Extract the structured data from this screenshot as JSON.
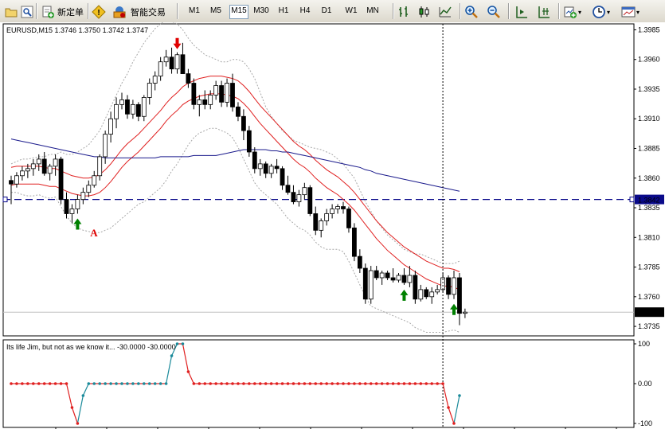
{
  "toolbar": {
    "new_order": "新定单",
    "auto_trading": "智能交易",
    "timeframes": [
      "M1",
      "M5",
      "M15",
      "M30",
      "H1",
      "H4",
      "D1",
      "W1",
      "MN"
    ],
    "active_timeframe": "M15",
    "icons": [
      "open-folder-icon",
      "zoom-fit-icon",
      "new-order-icon",
      "alert-icon",
      "auto-trading-icon",
      "bar-chart-icon",
      "candlestick-icon",
      "line-chart-icon",
      "zoom-in-icon",
      "zoom-out-icon",
      "chart-shift-icon",
      "autoscroll-icon",
      "add-indicator-icon",
      "period-clock-icon",
      "template-icon"
    ]
  },
  "chart_data": [
    {
      "type": "candlestick",
      "title": "EURUSD,M15  1.3746 1.3750 1.3742 1.3747",
      "ylim": [
        1.3727,
        1.399
      ],
      "yticks": [
        "1.3985",
        "1.3960",
        "1.3935",
        "1.3910",
        "1.3885",
        "1.3860",
        "1.3835",
        "1.3810",
        "1.3785",
        "1.3760",
        "1.3735"
      ],
      "current_price": "1.3747",
      "hline_price": "1.3842",
      "candles": [
        [
          1.3858,
          1.3862,
          1.3838,
          1.3855
        ],
        [
          1.3855,
          1.3865,
          1.3852,
          1.3862
        ],
        [
          1.3862,
          1.387,
          1.3858,
          1.3866
        ],
        [
          1.3866,
          1.3872,
          1.386,
          1.3868
        ],
        [
          1.3868,
          1.3876,
          1.3862,
          1.3872
        ],
        [
          1.3872,
          1.388,
          1.3866,
          1.3876
        ],
        [
          1.3876,
          1.3882,
          1.3862,
          1.3864
        ],
        [
          1.3864,
          1.3872,
          1.3858,
          1.387
        ],
        [
          1.387,
          1.388,
          1.3862,
          1.3876
        ],
        [
          1.3876,
          1.3878,
          1.3838,
          1.3842
        ],
        [
          1.3842,
          1.3848,
          1.3826,
          1.383
        ],
        [
          1.383,
          1.3838,
          1.3822,
          1.3834
        ],
        [
          1.3834,
          1.3846,
          1.383,
          1.3842
        ],
        [
          1.3842,
          1.3852,
          1.3838,
          1.3848
        ],
        [
          1.3848,
          1.3858,
          1.3844,
          1.3854
        ],
        [
          1.3854,
          1.3866,
          1.3852,
          1.3862
        ],
        [
          1.3862,
          1.388,
          1.3858,
          1.3878
        ],
        [
          1.3878,
          1.39,
          1.3872,
          1.3897
        ],
        [
          1.3897,
          1.3916,
          1.389,
          1.391
        ],
        [
          1.391,
          1.3928,
          1.3902,
          1.3922
        ],
        [
          1.3922,
          1.3932,
          1.3918,
          1.3926
        ],
        [
          1.3926,
          1.393,
          1.391,
          1.3914
        ],
        [
          1.3914,
          1.3926,
          1.391,
          1.3922
        ],
        [
          1.3922,
          1.3924,
          1.3908,
          1.3912
        ],
        [
          1.3912,
          1.393,
          1.3908,
          1.3928
        ],
        [
          1.3928,
          1.3944,
          1.3922,
          1.394
        ],
        [
          1.394,
          1.395,
          1.3934,
          1.3946
        ],
        [
          1.3946,
          1.3962,
          1.3942,
          1.3958
        ],
        [
          1.3958,
          1.3968,
          1.3954,
          1.3962
        ],
        [
          1.3962,
          1.397,
          1.3948,
          1.3952
        ],
        [
          1.3952,
          1.3966,
          1.3948,
          1.3964
        ],
        [
          1.3964,
          1.3974,
          1.3958,
          1.3948
        ],
        [
          1.3948,
          1.3952,
          1.3936,
          1.394
        ],
        [
          1.394,
          1.3944,
          1.3918,
          1.3922
        ],
        [
          1.3922,
          1.393,
          1.3912,
          1.3926
        ],
        [
          1.3926,
          1.3934,
          1.3918,
          1.3922
        ],
        [
          1.3922,
          1.3934,
          1.3918,
          1.393
        ],
        [
          1.393,
          1.3942,
          1.3926,
          1.3938
        ],
        [
          1.3938,
          1.3942,
          1.392,
          1.3924
        ],
        [
          1.3924,
          1.3944,
          1.392,
          1.394
        ],
        [
          1.394,
          1.3948,
          1.3916,
          1.392
        ],
        [
          1.392,
          1.3924,
          1.3908,
          1.3912
        ],
        [
          1.3912,
          1.3918,
          1.3892,
          1.39
        ],
        [
          1.39,
          1.3904,
          1.3878,
          1.3882
        ],
        [
          1.3882,
          1.3886,
          1.3864,
          1.3868
        ],
        [
          1.3868,
          1.3876,
          1.3862,
          1.3872
        ],
        [
          1.3872,
          1.3874,
          1.386,
          1.3864
        ],
        [
          1.3864,
          1.3872,
          1.386,
          1.387
        ],
        [
          1.387,
          1.3876,
          1.3864,
          1.3868
        ],
        [
          1.3868,
          1.387,
          1.385,
          1.3854
        ],
        [
          1.3854,
          1.3862,
          1.3846,
          1.3848
        ],
        [
          1.3848,
          1.3854,
          1.3838,
          1.384
        ],
        [
          1.384,
          1.385,
          1.3836,
          1.3846
        ],
        [
          1.3846,
          1.3856,
          1.3842,
          1.3852
        ],
        [
          1.3852,
          1.3854,
          1.3828,
          1.383
        ],
        [
          1.383,
          1.3836,
          1.3812,
          1.3816
        ],
        [
          1.3816,
          1.3826,
          1.381,
          1.3824
        ],
        [
          1.3824,
          1.3834,
          1.382,
          1.383
        ],
        [
          1.383,
          1.3838,
          1.3826,
          1.3834
        ],
        [
          1.3834,
          1.3838,
          1.383,
          1.3836
        ],
        [
          1.3836,
          1.384,
          1.383,
          1.3834
        ],
        [
          1.3834,
          1.3836,
          1.3814,
          1.3818
        ],
        [
          1.3818,
          1.3822,
          1.379,
          1.3794
        ],
        [
          1.3794,
          1.38,
          1.378,
          1.3784
        ],
        [
          1.3784,
          1.3788,
          1.3754,
          1.3758
        ],
        [
          1.3758,
          1.3786,
          1.3754,
          1.3782
        ],
        [
          1.3782,
          1.3786,
          1.3774,
          1.3776
        ],
        [
          1.3776,
          1.3782,
          1.377,
          1.378
        ],
        [
          1.378,
          1.3782,
          1.3774,
          1.3776
        ],
        [
          1.3776,
          1.3784,
          1.3772,
          1.3774
        ],
        [
          1.3774,
          1.378,
          1.3772,
          1.3778
        ],
        [
          1.3778,
          1.3784,
          1.377,
          1.3772
        ],
        [
          1.3772,
          1.3786,
          1.3768,
          1.3778
        ],
        [
          1.3778,
          1.3782,
          1.3754,
          1.3758
        ],
        [
          1.3758,
          1.377,
          1.3756,
          1.3766
        ],
        [
          1.3766,
          1.3768,
          1.3758,
          1.376
        ],
        [
          1.376,
          1.3768,
          1.3754,
          1.3764
        ],
        [
          1.3764,
          1.377,
          1.3762,
          1.3766
        ],
        [
          1.3766,
          1.378,
          1.3764,
          1.3776
        ],
        [
          1.3776,
          1.3778,
          1.3758,
          1.3762
        ],
        [
          1.3762,
          1.3782,
          1.3758,
          1.3776
        ],
        [
          1.3776,
          1.378,
          1.3736,
          1.3746
        ],
        [
          1.3746,
          1.375,
          1.3742,
          1.3747
        ]
      ],
      "overlays": [
        {
          "name": "bb-upper",
          "color": "#a8a8a8",
          "style": "dotted",
          "values": [
            1.3872,
            1.3874,
            1.3876,
            1.3876,
            1.3877,
            1.3878,
            1.3878,
            1.388,
            1.388,
            1.3882,
            1.388,
            1.388,
            1.3882,
            1.3885,
            1.3888,
            1.3894,
            1.39,
            1.391,
            1.392,
            1.393,
            1.394,
            1.3948,
            1.3958,
            1.3966,
            1.3974,
            1.398,
            1.3986,
            1.399,
            1.3994,
            1.3992,
            1.399,
            1.3985,
            1.3978,
            1.3972,
            1.3968,
            1.3964,
            1.3962,
            1.396,
            1.3958,
            1.3958,
            1.396,
            1.396,
            1.3958,
            1.3952,
            1.3944,
            1.3932,
            1.392,
            1.3912,
            1.3906,
            1.39,
            1.3896,
            1.3892,
            1.389,
            1.3888,
            1.3886,
            1.3885,
            1.3884,
            1.3882,
            1.388,
            1.3876,
            1.3872,
            1.3866,
            1.386,
            1.385,
            1.384,
            1.3832,
            1.3824,
            1.3818,
            1.3812,
            1.3808,
            1.3804,
            1.38,
            1.3798,
            1.3796,
            1.3796,
            1.3794,
            1.3792,
            1.379,
            1.3788,
            1.3788,
            1.3788,
            1.379
          ]
        },
        {
          "name": "bb-lower",
          "color": "#a8a8a8",
          "style": "dotted",
          "values": [
            1.3848,
            1.3848,
            1.3846,
            1.3845,
            1.3845,
            1.3846,
            1.3844,
            1.3843,
            1.3844,
            1.3836,
            1.3828,
            1.3822,
            1.3818,
            1.3816,
            1.3815,
            1.3814,
            1.3814,
            1.3816,
            1.3818,
            1.3822,
            1.3826,
            1.383,
            1.3834,
            1.3838,
            1.384,
            1.3844,
            1.3848,
            1.3852,
            1.3858,
            1.3866,
            1.3872,
            1.388,
            1.3888,
            1.3894,
            1.3898,
            1.39,
            1.3902,
            1.3902,
            1.39,
            1.3898,
            1.3894,
            1.3886,
            1.3876,
            1.3866,
            1.3856,
            1.385,
            1.3846,
            1.3842,
            1.3838,
            1.3832,
            1.3826,
            1.3822,
            1.3818,
            1.3816,
            1.3812,
            1.3806,
            1.3802,
            1.38,
            1.38,
            1.38,
            1.3798,
            1.379,
            1.378,
            1.377,
            1.376,
            1.3752,
            1.375,
            1.3748,
            1.3746,
            1.3744,
            1.3742,
            1.374,
            1.3738,
            1.3734,
            1.3732,
            1.373,
            1.373,
            1.373,
            1.373,
            1.3731,
            1.3732,
            1.373
          ]
        },
        {
          "name": "env-upper",
          "color": "#e02020",
          "style": "solid",
          "values": [
            1.3869,
            1.387,
            1.387,
            1.387,
            1.387,
            1.387,
            1.3869,
            1.3868,
            1.3868,
            1.3866,
            1.3864,
            1.3862,
            1.3861,
            1.386,
            1.386,
            1.3861,
            1.3863,
            1.3867,
            1.3872,
            1.3878,
            1.3884,
            1.3889,
            1.3893,
            1.3897,
            1.3902,
            1.3907,
            1.3912,
            1.3917,
            1.3923,
            1.3928,
            1.3932,
            1.3937,
            1.394,
            1.3942,
            1.3944,
            1.3945,
            1.3946,
            1.3946,
            1.3946,
            1.3945,
            1.3944,
            1.3942,
            1.3938,
            1.3933,
            1.3927,
            1.3921,
            1.3916,
            1.3911,
            1.3906,
            1.3901,
            1.3896,
            1.3891,
            1.3887,
            1.3884,
            1.388,
            1.3875,
            1.3871,
            1.3867,
            1.3864,
            1.3861,
            1.3857,
            1.3853,
            1.3848,
            1.3842,
            1.3836,
            1.383,
            1.3824,
            1.3819,
            1.3814,
            1.381,
            1.3806,
            1.3802,
            1.3799,
            1.3796,
            1.3793,
            1.379,
            1.3788,
            1.3786,
            1.3784,
            1.3784,
            1.3783,
            1.3781
          ]
        },
        {
          "name": "env-lower",
          "color": "#e02020",
          "style": "solid",
          "values": [
            1.3854,
            1.3855,
            1.3855,
            1.3855,
            1.3855,
            1.3855,
            1.3854,
            1.3853,
            1.3853,
            1.3851,
            1.3849,
            1.3847,
            1.3846,
            1.3845,
            1.3845,
            1.3846,
            1.3848,
            1.3852,
            1.3857,
            1.3863,
            1.3869,
            1.3874,
            1.3878,
            1.3882,
            1.3887,
            1.3892,
            1.3897,
            1.3902,
            1.3908,
            1.3913,
            1.3917,
            1.3922,
            1.3925,
            1.3927,
            1.3929,
            1.393,
            1.3931,
            1.3931,
            1.3931,
            1.393,
            1.3929,
            1.3927,
            1.3923,
            1.3918,
            1.3912,
            1.3906,
            1.3901,
            1.3896,
            1.3891,
            1.3886,
            1.3881,
            1.3876,
            1.3872,
            1.3869,
            1.3865,
            1.386,
            1.3856,
            1.3852,
            1.3849,
            1.3846,
            1.3842,
            1.3838,
            1.3833,
            1.3827,
            1.3821,
            1.3815,
            1.3809,
            1.3804,
            1.3799,
            1.3795,
            1.3791,
            1.3787,
            1.3784,
            1.3781,
            1.3778,
            1.3775,
            1.3773,
            1.3771,
            1.3769,
            1.3769,
            1.3768,
            1.3766
          ]
        },
        {
          "name": "ma-slow",
          "color": "#1a1a8c",
          "style": "solid",
          "values": [
            1.3893,
            1.3892,
            1.3891,
            1.389,
            1.3889,
            1.3888,
            1.3887,
            1.3886,
            1.3885,
            1.3884,
            1.3883,
            1.3882,
            1.3881,
            1.388,
            1.3879,
            1.3878,
            1.3878,
            1.3877,
            1.3877,
            1.3877,
            1.3877,
            1.3877,
            1.3877,
            1.3877,
            1.3877,
            1.3877,
            1.3877,
            1.3878,
            1.3878,
            1.3878,
            1.3878,
            1.3878,
            1.3878,
            1.3879,
            1.3879,
            1.3879,
            1.3879,
            1.3879,
            1.388,
            1.3881,
            1.3882,
            1.3883,
            1.3884,
            1.3884,
            1.3884,
            1.3884,
            1.3884,
            1.3883,
            1.3883,
            1.3882,
            1.3882,
            1.3881,
            1.388,
            1.3879,
            1.3878,
            1.3877,
            1.3876,
            1.3875,
            1.3874,
            1.3873,
            1.3872,
            1.3871,
            1.387,
            1.3869,
            1.3867,
            1.3866,
            1.3864,
            1.3863,
            1.3862,
            1.3861,
            1.386,
            1.3859,
            1.3858,
            1.3857,
            1.3856,
            1.3855,
            1.3854,
            1.3853,
            1.3852,
            1.3851,
            1.385,
            1.3849
          ]
        }
      ],
      "signal_arrows": [
        {
          "index": 30,
          "direction": "down",
          "color": "#e00000"
        },
        {
          "index": 12,
          "direction": "up",
          "color": "#008000"
        },
        {
          "index": 71,
          "direction": "up",
          "color": "#008000"
        },
        {
          "index": 80,
          "direction": "up",
          "color": "#008000"
        }
      ],
      "annotations": [
        {
          "text": "A",
          "index": 14,
          "price": 1.3815,
          "color": "#e00000"
        }
      ]
    },
    {
      "type": "line",
      "title": "Its life Jim, but not as we know it...  -30.0000 -30.0000",
      "ylim": [
        -110,
        110
      ],
      "yticks": [
        "100",
        "0.00",
        "-100"
      ],
      "series": [
        {
          "color_pos": "#e02020",
          "color_neg": "#e02020",
          "values": [
            0,
            0,
            0,
            0,
            0,
            0,
            0,
            0,
            0,
            0,
            0,
            -60,
            -100,
            -30,
            0,
            0,
            0,
            0,
            0,
            0,
            0,
            0,
            0,
            0,
            0,
            0,
            0,
            0,
            0,
            70,
            100,
            100,
            30,
            0,
            0,
            0,
            0,
            0,
            0,
            0,
            0,
            0,
            0,
            0,
            0,
            0,
            0,
            0,
            0,
            0,
            0,
            0,
            0,
            0,
            0,
            0,
            0,
            0,
            0,
            0,
            0,
            0,
            0,
            0,
            0,
            0,
            0,
            0,
            0,
            0,
            0,
            0,
            0,
            0,
            0,
            0,
            0,
            0,
            0,
            -60,
            -100,
            -30
          ]
        }
      ]
    }
  ]
}
